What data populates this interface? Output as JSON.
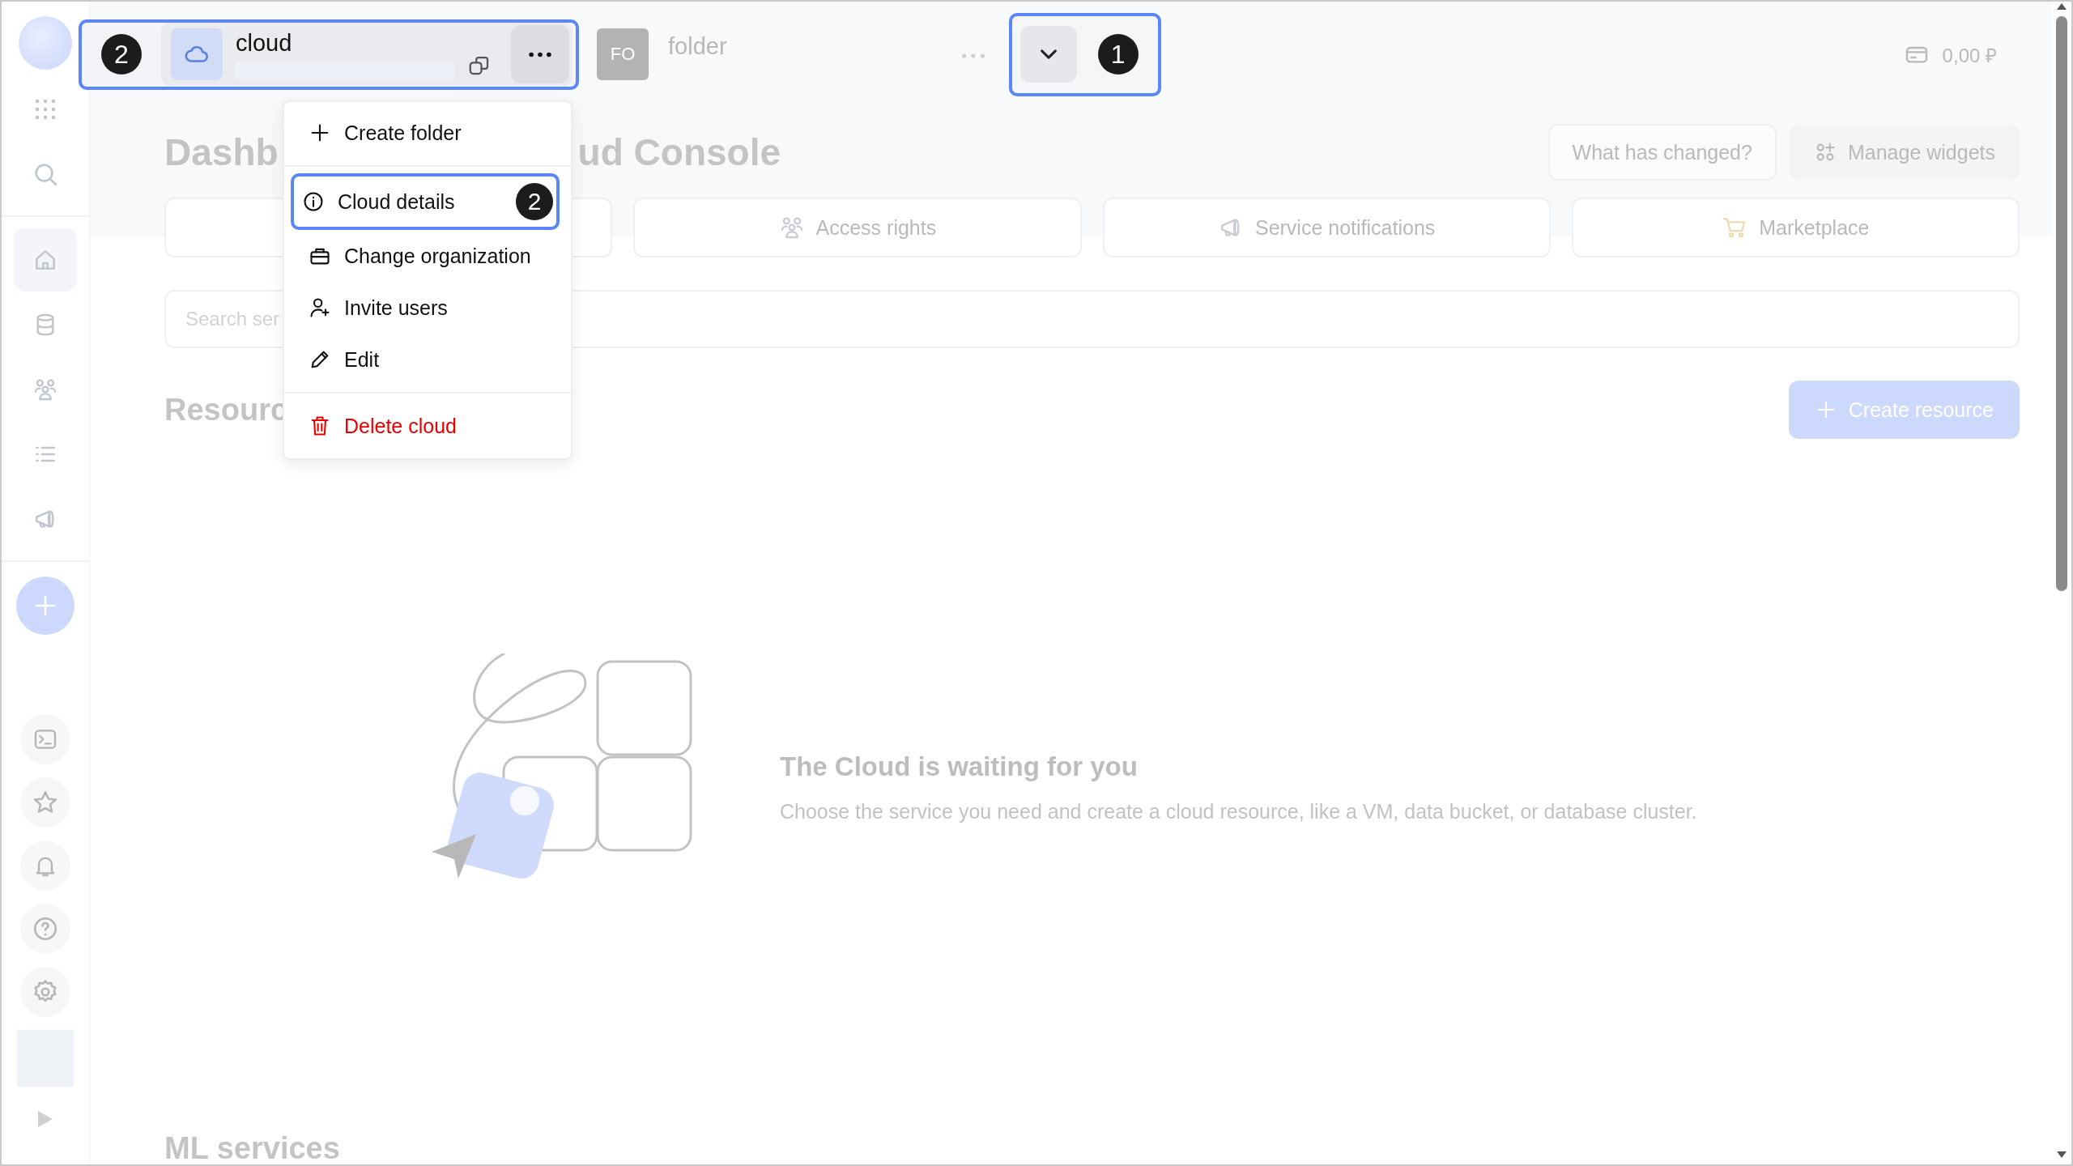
{
  "sidebar": {
    "items": [
      {
        "selected": true
      },
      {
        "selected": false
      },
      {
        "selected": false
      },
      {
        "selected": false
      },
      {
        "selected": false
      }
    ]
  },
  "header": {
    "cloud": {
      "name": "cloud",
      "callout": "2"
    },
    "folder": {
      "initials": "FO",
      "name": "folder"
    },
    "expand_callout": "1",
    "balance": "0,00 ₽"
  },
  "title_parts": [
    "Dashb",
    "ud Console"
  ],
  "actions": [
    "What has changed?",
    "Manage widgets"
  ],
  "shortcuts": [
    {
      "kind": "blank"
    },
    {
      "kind": "link",
      "label": "Access rights"
    },
    {
      "kind": "link",
      "label": "Service notifications"
    },
    {
      "kind": "link",
      "label": "Marketplace"
    }
  ],
  "search": {
    "placeholder": "Search ser"
  },
  "resources": {
    "title": "Resourc",
    "create_button": "Create resource"
  },
  "empty_state": {
    "title": "The Cloud is waiting for you",
    "text": "Choose the service you need and create a cloud resource, like a VM, data bucket, or database cluster."
  },
  "next_section": "ML services",
  "menu": {
    "items": [
      {
        "kind": "action",
        "label": "Create folder",
        "divider_before": false,
        "highlighted": false
      },
      {
        "kind": "action",
        "label": "Cloud details",
        "divider_before": true,
        "highlighted": true,
        "callout": "2"
      },
      {
        "kind": "action",
        "label": "Change organization",
        "divider_before": false,
        "highlighted": false
      },
      {
        "kind": "action",
        "label": "Invite users",
        "divider_before": false,
        "highlighted": false
      },
      {
        "kind": "action",
        "label": "Edit",
        "divider_before": false,
        "highlighted": false
      },
      {
        "kind": "danger",
        "label": "Delete cloud",
        "divider_before": true,
        "highlighted": false
      }
    ]
  }
}
